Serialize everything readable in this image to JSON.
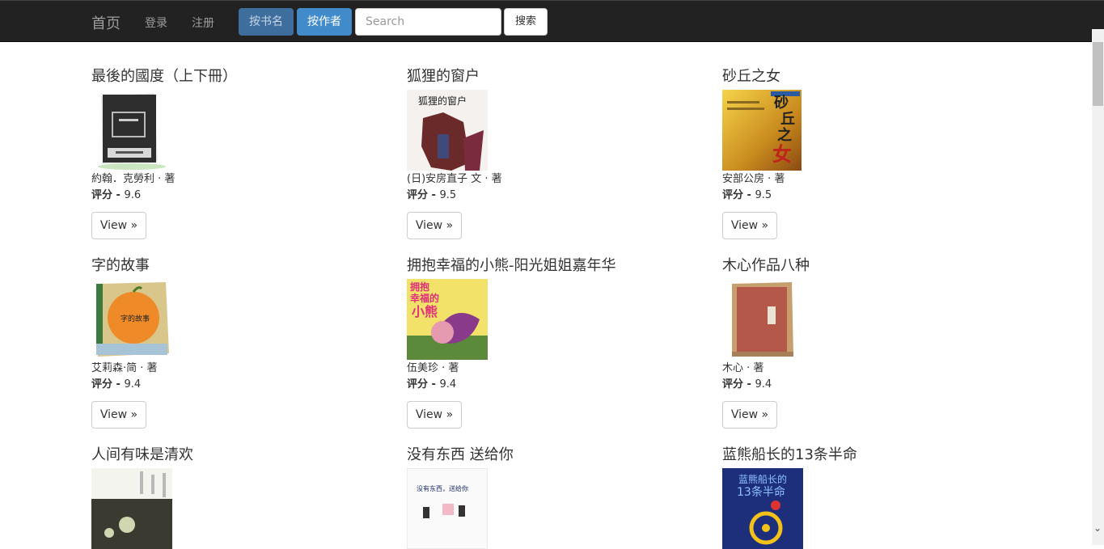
{
  "nav": {
    "brand": "首页",
    "login": "登录",
    "register": "注册",
    "by_title": "按书名",
    "by_author": "按作者",
    "search_placeholder": "Search",
    "search_button": "搜索"
  },
  "rating_label": "评分 - ",
  "view_label": "View »",
  "books": [
    {
      "title": "最後的國度（上下冊）",
      "author": "約翰．克勞利 · 著",
      "rating": "9.6"
    },
    {
      "title": "狐狸的窗户",
      "author": "(日)安房直子 文 · 著",
      "rating": "9.5"
    },
    {
      "title": "砂丘之女",
      "author": "安部公房 · 著",
      "rating": "9.5"
    },
    {
      "title": "字的故事",
      "author": "艾莉森·简 · 著",
      "rating": "9.4"
    },
    {
      "title": "拥抱幸福的小熊-阳光姐姐嘉年华",
      "author": "伍美珍 · 著",
      "rating": "9.4"
    },
    {
      "title": "木心作品八种",
      "author": "木心 · 著",
      "rating": "9.4"
    },
    {
      "title": "人间有味是清欢",
      "author": "",
      "rating": ""
    },
    {
      "title": "没有东西 送给你",
      "author": "",
      "rating": ""
    },
    {
      "title": "蓝熊船长的13条半命",
      "author": "",
      "rating": ""
    }
  ],
  "cover_texts": {
    "c2": "狐狸的窗户",
    "c3a": "砂",
    "c3b": "丘",
    "c3c": "之",
    "c3d": "女",
    "c4": "字的故事",
    "c5a": "拥抱",
    "c5b": "幸福的",
    "c5c": "小熊",
    "c8": "没有东西，送给你",
    "c9a": "蓝熊船长的",
    "c9b": "13条半命"
  }
}
